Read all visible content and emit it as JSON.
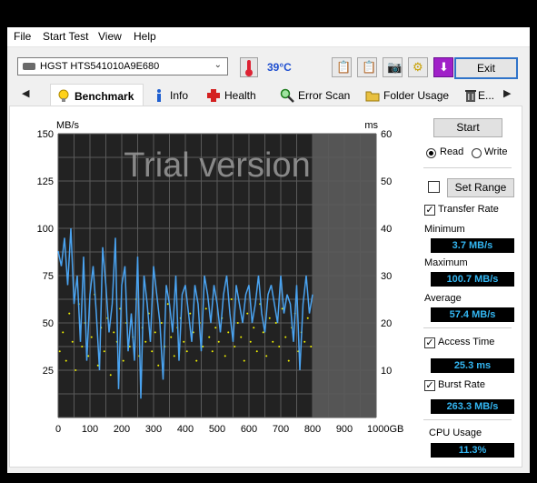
{
  "menu": {
    "items": [
      "File",
      "Start Test",
      "View",
      "Help"
    ]
  },
  "toolbar": {
    "drive": "HGST HTS541010A9E680",
    "temperature": "39°C",
    "exit_label": "Exit",
    "buttons": [
      "copy-text-icon",
      "copy-image-icon",
      "screenshot-icon",
      "options-icon",
      "save-icon"
    ]
  },
  "tabs": [
    {
      "label": "Benchmark",
      "icon": "lightbulb-icon"
    },
    {
      "label": "Info",
      "icon": "info-icon"
    },
    {
      "label": "Health",
      "icon": "health-cross-icon"
    },
    {
      "label": "Error Scan",
      "icon": "magnifier-icon"
    },
    {
      "label": "Folder Usage",
      "icon": "folder-icon"
    },
    {
      "label": "E...",
      "icon": "trash-icon"
    }
  ],
  "benchmark": {
    "start_label": "Start",
    "read_label": "Read",
    "write_label": "Write",
    "set_range_label": "Set Range",
    "transfer_rate_label": "Transfer Rate",
    "minimum_label": "Minimum",
    "minimum_value": "3.7 MB/s",
    "maximum_label": "Maximum",
    "maximum_value": "100.7 MB/s",
    "average_label": "Average",
    "average_value": "57.4 MB/s",
    "access_time_label": "Access Time",
    "access_time_value": "25.3 ms",
    "burst_rate_label": "Burst Rate",
    "burst_rate_value": "263.3 MB/s",
    "cpu_usage_label": "CPU Usage",
    "cpu_usage_value": "11.3%",
    "read_selected": true,
    "transfer_rate_checked": true,
    "access_time_checked": true,
    "burst_rate_checked": true,
    "range_checked": false
  },
  "chart_data": {
    "type": "line",
    "watermark": "Trial version",
    "y_left_unit": "MB/s",
    "y_right_unit": "ms",
    "x_unit": "GB",
    "x_ticks": [
      "0",
      "100",
      "200",
      "300",
      "400",
      "500",
      "600",
      "700",
      "800",
      "900",
      "1000"
    ],
    "y_left_ticks": [
      "25",
      "50",
      "75",
      "100",
      "125",
      "150"
    ],
    "y_right_ticks": [
      "10",
      "20",
      "30",
      "40",
      "50",
      "60"
    ],
    "xlim": [
      0,
      1000
    ],
    "ylim_left": [
      0,
      150
    ],
    "ylim_right": [
      0,
      60
    ],
    "tested_until_gb": 800,
    "colors": {
      "transfer_line": "#4aa3f0",
      "access_dots": "#f0f000",
      "plot_bg": "#222222",
      "untested_bg": "#555555",
      "grid": "#5a5a5a"
    },
    "series": [
      {
        "name": "Transfer Rate",
        "x": [
          0,
          10,
          20,
          30,
          40,
          50,
          60,
          70,
          80,
          90,
          100,
          110,
          120,
          130,
          140,
          150,
          160,
          170,
          180,
          190,
          200,
          210,
          220,
          230,
          240,
          250,
          260,
          270,
          280,
          290,
          300,
          310,
          320,
          330,
          340,
          350,
          360,
          370,
          380,
          390,
          400,
          410,
          420,
          430,
          440,
          450,
          460,
          470,
          480,
          490,
          500,
          510,
          520,
          530,
          540,
          550,
          560,
          570,
          580,
          590,
          600,
          610,
          620,
          630,
          640,
          650,
          660,
          670,
          680,
          690,
          700,
          710,
          720,
          730,
          740,
          750,
          760,
          770,
          780,
          790,
          800
        ],
        "y": [
          88,
          80,
          95,
          70,
          100,
          60,
          75,
          40,
          85,
          30,
          65,
          80,
          55,
          25,
          90,
          70,
          45,
          60,
          95,
          15,
          70,
          80,
          35,
          55,
          30,
          85,
          10,
          75,
          60,
          40,
          80,
          65,
          50,
          20,
          70,
          60,
          45,
          75,
          30,
          65,
          70,
          55,
          40,
          70,
          60,
          35,
          75,
          65,
          50,
          70,
          60,
          45,
          65,
          75,
          55,
          40,
          70,
          60,
          50,
          65,
          70,
          50,
          60,
          75,
          55,
          45,
          65,
          70,
          60,
          50,
          75,
          55,
          65,
          60,
          40,
          70,
          25,
          60,
          75,
          55,
          65
        ]
      },
      {
        "name": "Access Time",
        "unit": "ms",
        "x": [
          5,
          15,
          25,
          35,
          45,
          55,
          65,
          75,
          85,
          95,
          105,
          115,
          125,
          135,
          145,
          155,
          165,
          175,
          185,
          195,
          205,
          215,
          225,
          235,
          245,
          255,
          265,
          275,
          285,
          295,
          305,
          315,
          325,
          335,
          345,
          355,
          365,
          375,
          385,
          395,
          405,
          415,
          425,
          435,
          445,
          455,
          465,
          475,
          485,
          495,
          505,
          515,
          525,
          535,
          545,
          555,
          565,
          575,
          585,
          595,
          605,
          615,
          625,
          635,
          645,
          655,
          665,
          675,
          685,
          695,
          705,
          715,
          725,
          735,
          745,
          755,
          765,
          775,
          785,
          795
        ],
        "y": [
          14,
          18,
          12,
          22,
          16,
          10,
          24,
          15,
          20,
          13,
          17,
          26,
          11,
          19,
          14,
          21,
          9,
          18,
          16,
          23,
          12,
          20,
          15,
          17,
          25,
          13,
          19,
          16,
          22,
          14,
          18,
          11,
          20,
          15,
          24,
          17,
          13,
          19,
          21,
          16,
          14,
          22,
          18,
          12,
          20,
          15,
          23,
          17,
          14,
          19,
          16,
          21,
          13,
          18,
          25,
          15,
          20,
          17,
          12,
          22,
          16,
          19,
          14,
          24,
          18,
          13,
          21,
          16,
          20,
          15,
          23,
          17,
          12,
          19,
          22,
          14,
          18,
          16,
          21,
          15
        ]
      }
    ]
  }
}
